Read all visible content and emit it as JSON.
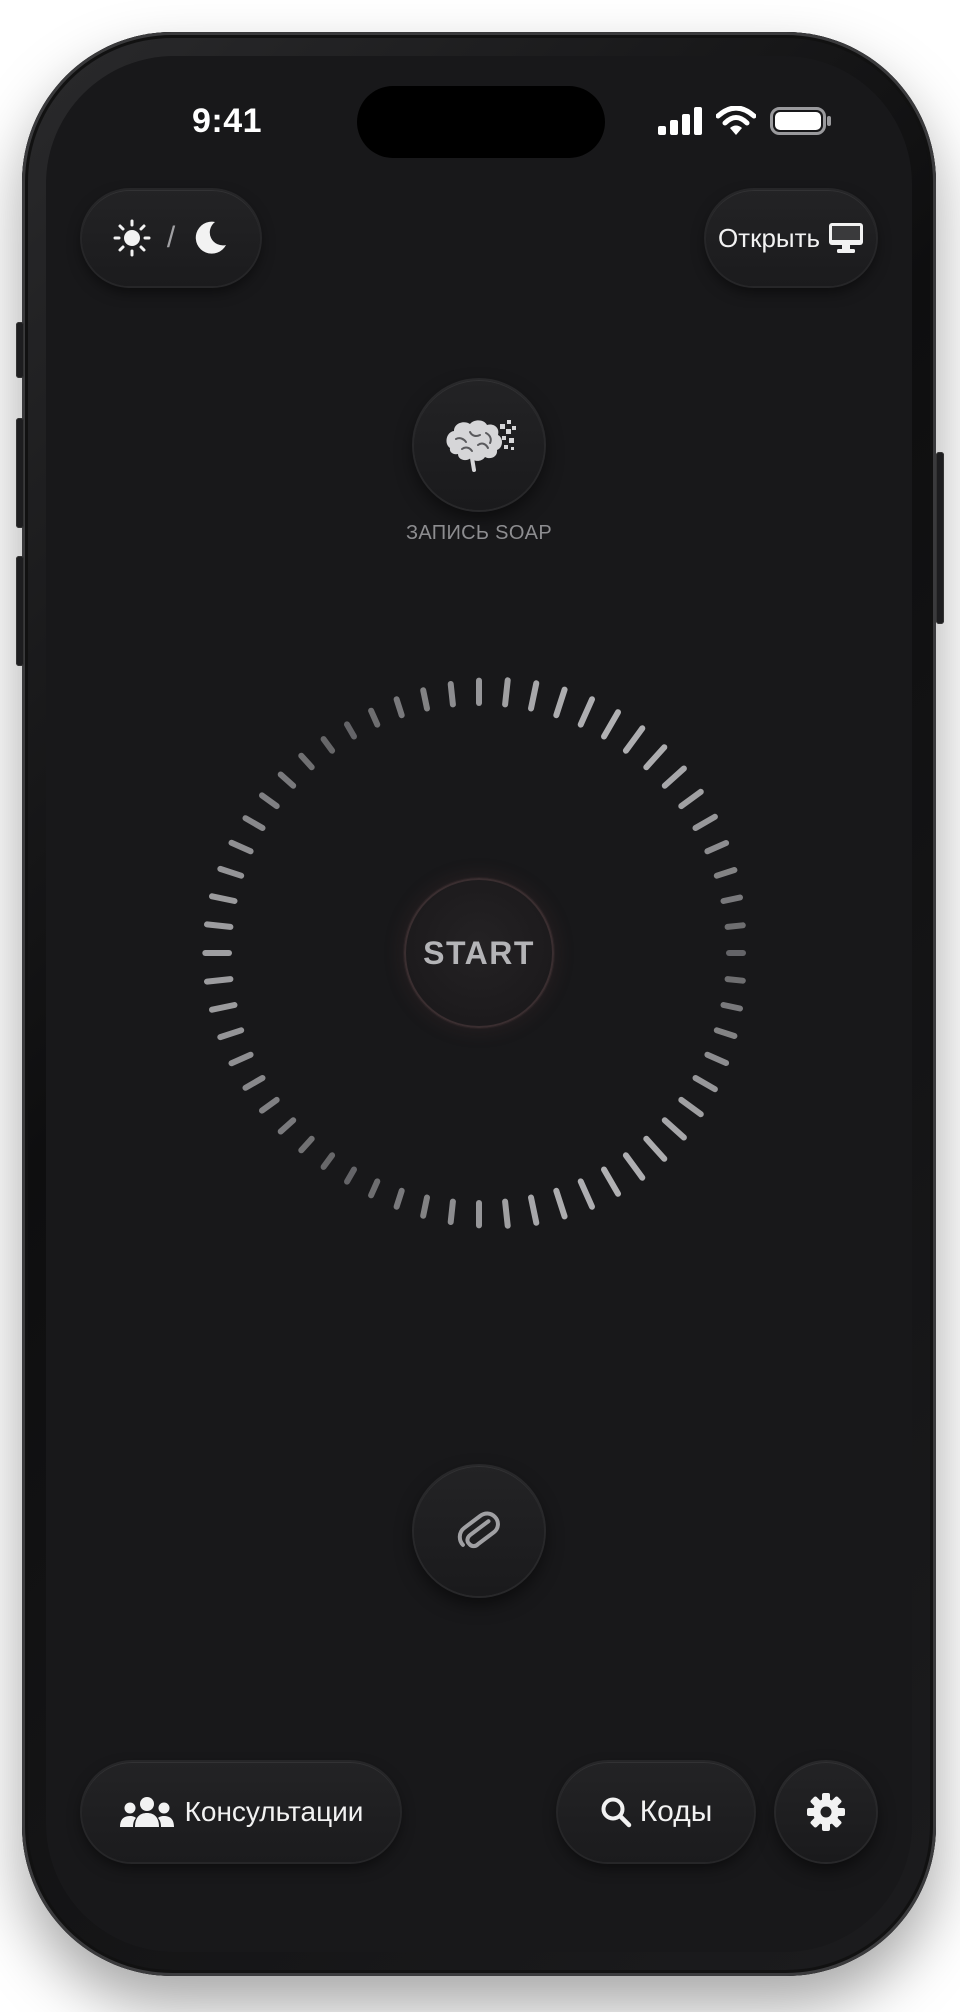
{
  "status_bar": {
    "time": "9:41",
    "icons": [
      "cellular-signal-icon",
      "wifi-icon",
      "battery-icon"
    ]
  },
  "header": {
    "theme_toggle": {
      "icons": [
        "sun-icon",
        "moon-icon"
      ],
      "separator": "/"
    },
    "open_button": {
      "label": "Открыть",
      "icon": "desktop-monitor-icon"
    }
  },
  "soap": {
    "icon": "brain-icon",
    "label": "ЗАПИСЬ SOAP"
  },
  "recorder": {
    "start_label": "START",
    "ring_icon": "tick-ring"
  },
  "attach": {
    "icon": "paperclip-icon"
  },
  "bottom_bar": {
    "consultations": {
      "label": "Консультации",
      "icon": "users-icon"
    },
    "codes": {
      "label": "Коды",
      "icon": "search-icon"
    },
    "settings": {
      "icon": "gear-icon"
    }
  },
  "colors": {
    "screen_background": "#18181a",
    "button_surface": "#1f1f21",
    "text_primary": "#f2f2f2",
    "text_muted": "#8d8d90"
  }
}
